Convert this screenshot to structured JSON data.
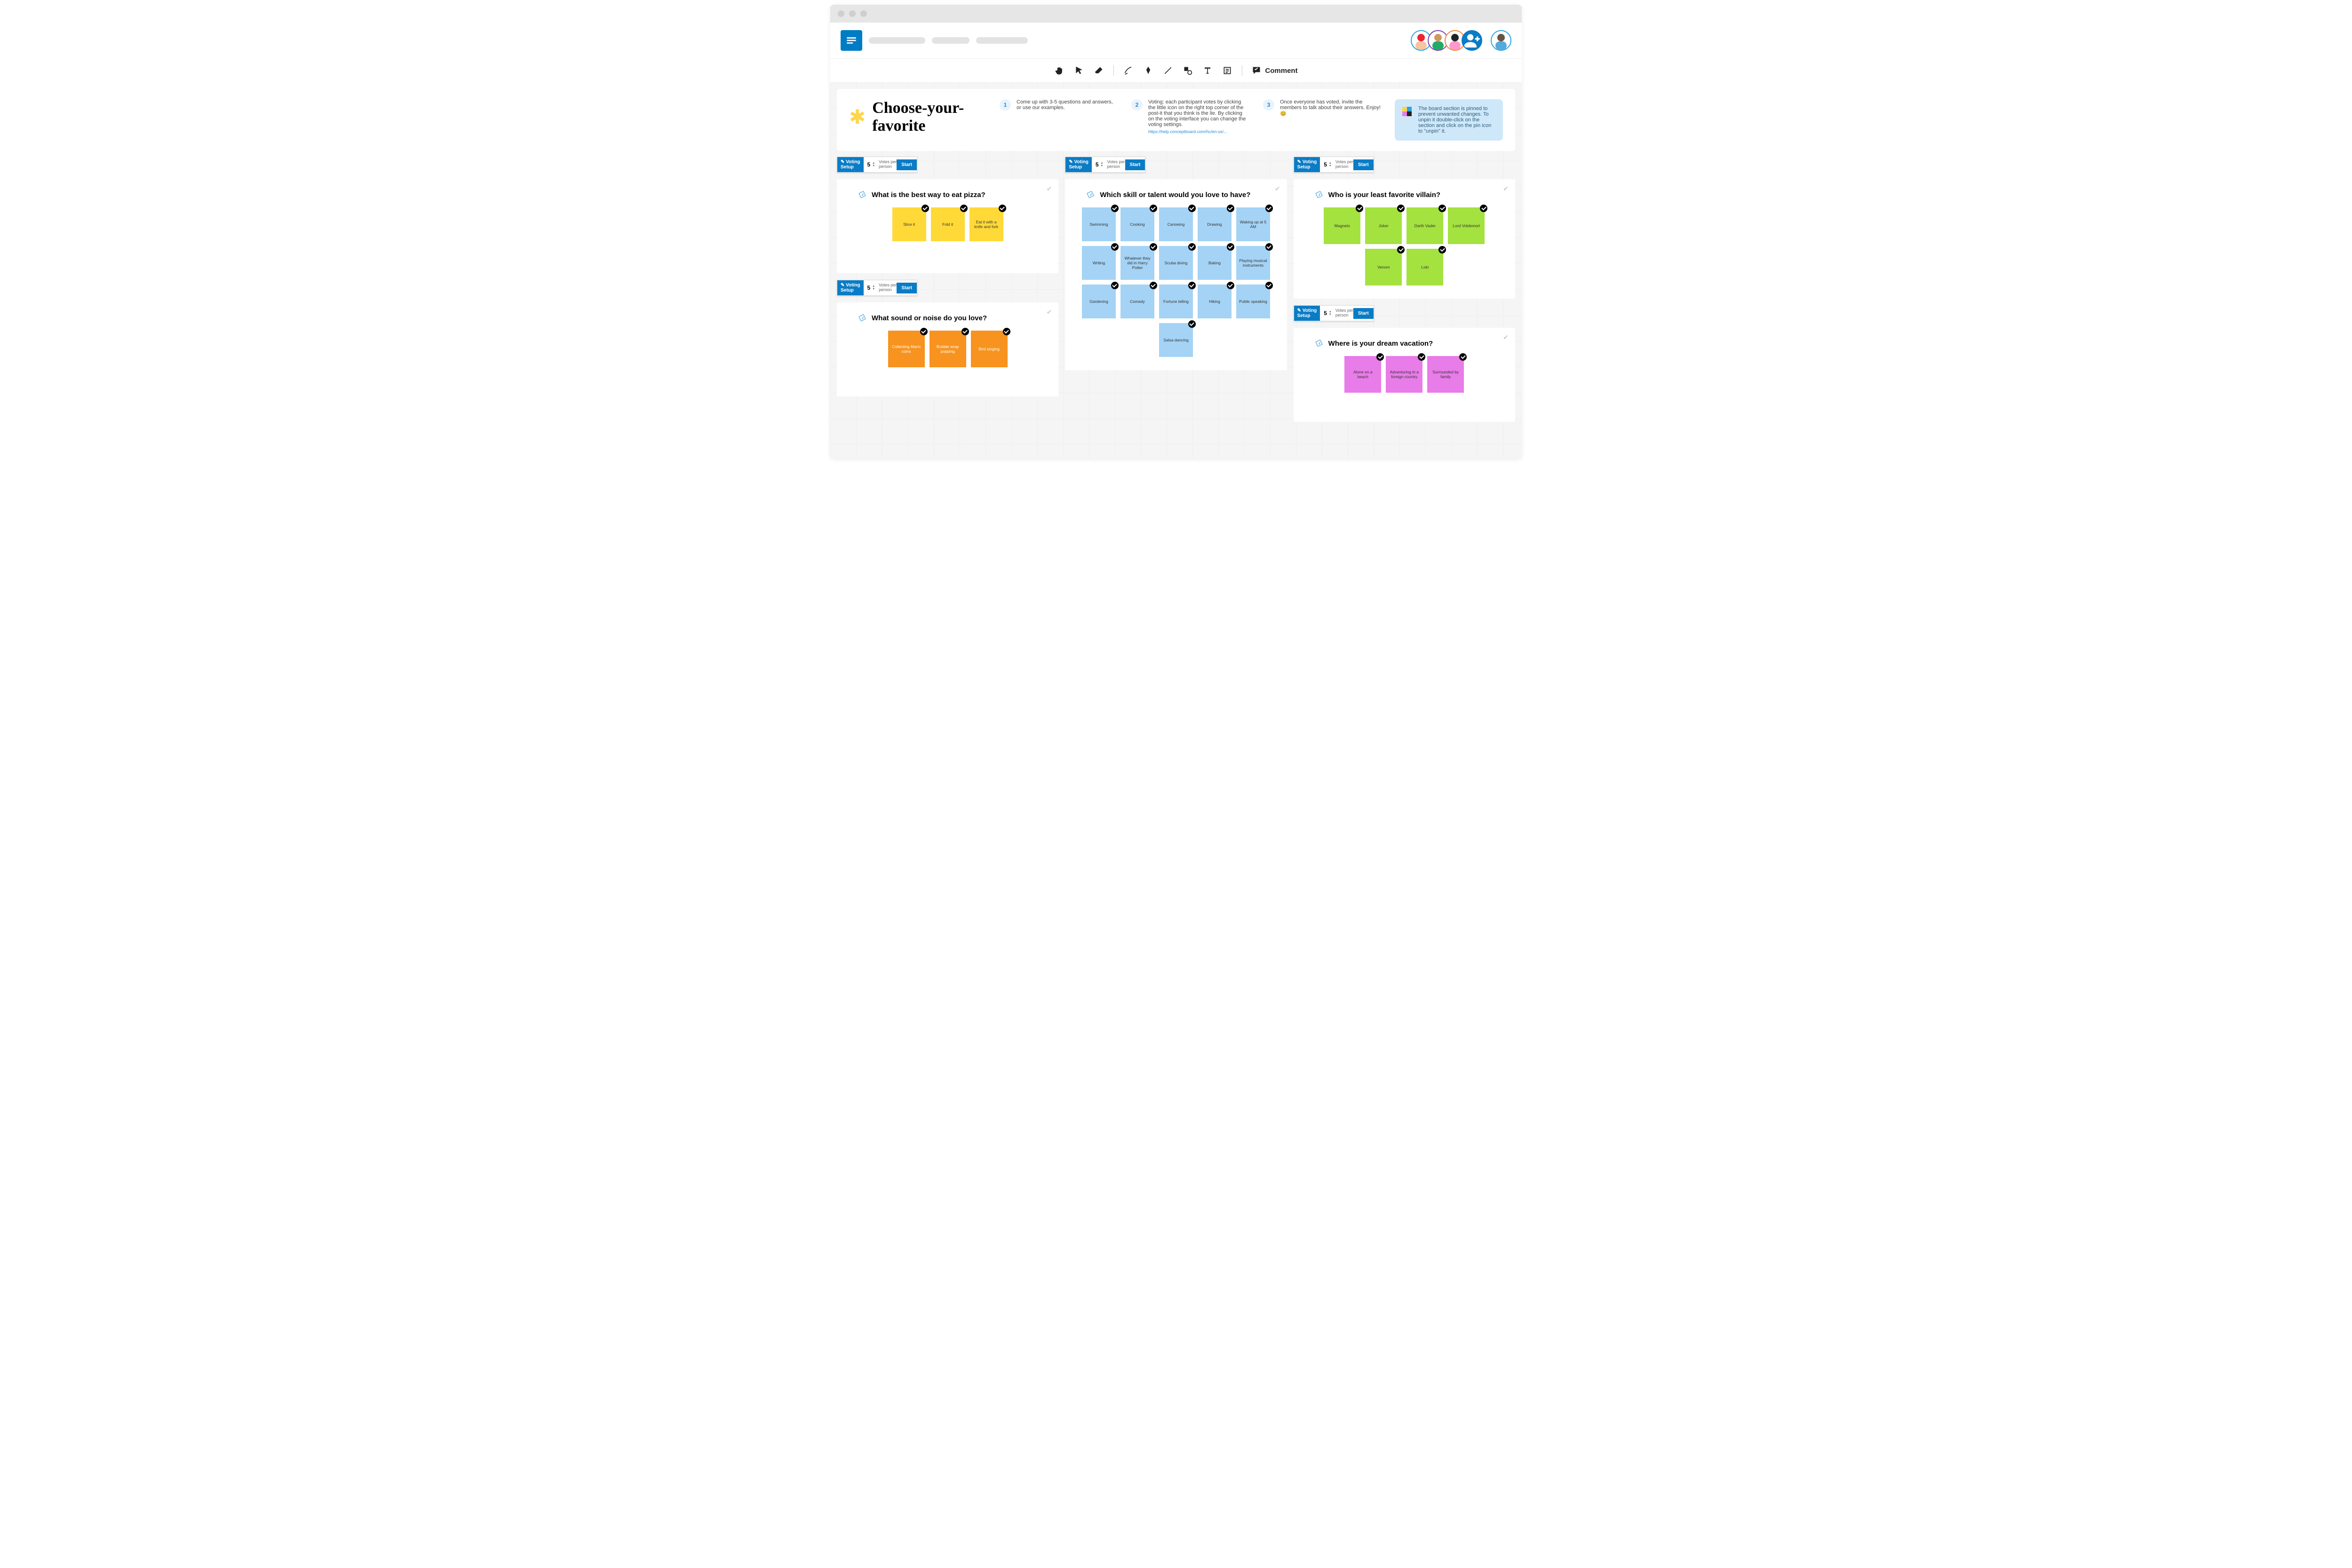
{
  "header": {
    "title": "Choose-your-favorite",
    "steps": [
      {
        "num": "1",
        "text": "Come up with 3-5 questions and answers, or use our examples."
      },
      {
        "num": "2",
        "text": "Voting: each participant votes by clicking the little icon on the right top corner of the post-it that you think is the lie. By clicking on the voting interface you can change the voting settings.",
        "link": "https://help.conceptboard.com/hc/en-us/..."
      },
      {
        "num": "3",
        "text": "Once everyone has voted, invite the members to talk about their answers. Enjoy! 😊"
      }
    ],
    "tip": "The board section is pinned to prevent unwanted changes. To unpin it double-click on the section and click on the pin icon to \"unpin\" it."
  },
  "voting": {
    "setup": "✎ Voting\nSetup",
    "count": "5",
    "label": "Votes per\nperson",
    "start": "Start"
  },
  "toolbar": {
    "comment": "Comment"
  },
  "boards": {
    "c1": [
      {
        "q": "What is the best way to eat pizza?",
        "color": "yellow",
        "size": "",
        "notes": [
          "Slice it",
          "Fold it",
          "Eat it with a knife and fork"
        ]
      },
      {
        "q": "What sound or noise do you love?",
        "color": "orange",
        "size": "lg",
        "notes": [
          "Collecting Mario coins",
          "Bubble wrap popping",
          "Bird singing"
        ]
      }
    ],
    "c2": [
      {
        "q": "Which skill or talent would you love to have?",
        "color": "blue",
        "size": "",
        "notes": [
          "Swimming",
          "Cooking",
          "Canoeing",
          "Drawing",
          "Waking up at 5 AM",
          "Writing",
          "Whatever they did in Harry Potter",
          "Scuba diving",
          "Baking",
          "Playing musical instruments",
          "Gardening",
          "Comedy",
          "Fortune telling",
          "Hiking",
          "Public speaking",
          "Salsa dancing"
        ]
      }
    ],
    "c3": [
      {
        "q": "Who is your least favorite villain?",
        "color": "green",
        "size": "lg",
        "notes": [
          "Magneto",
          "Joker",
          "Darth Vader",
          "Lord Voldemort",
          "Venom",
          "Loki"
        ]
      },
      {
        "q": "Where is your dream vacation?",
        "color": "pink",
        "size": "lg",
        "notes": [
          "Alone on a beach",
          "Adventuring in a foreign country",
          "Surrounded by family"
        ]
      }
    ]
  }
}
